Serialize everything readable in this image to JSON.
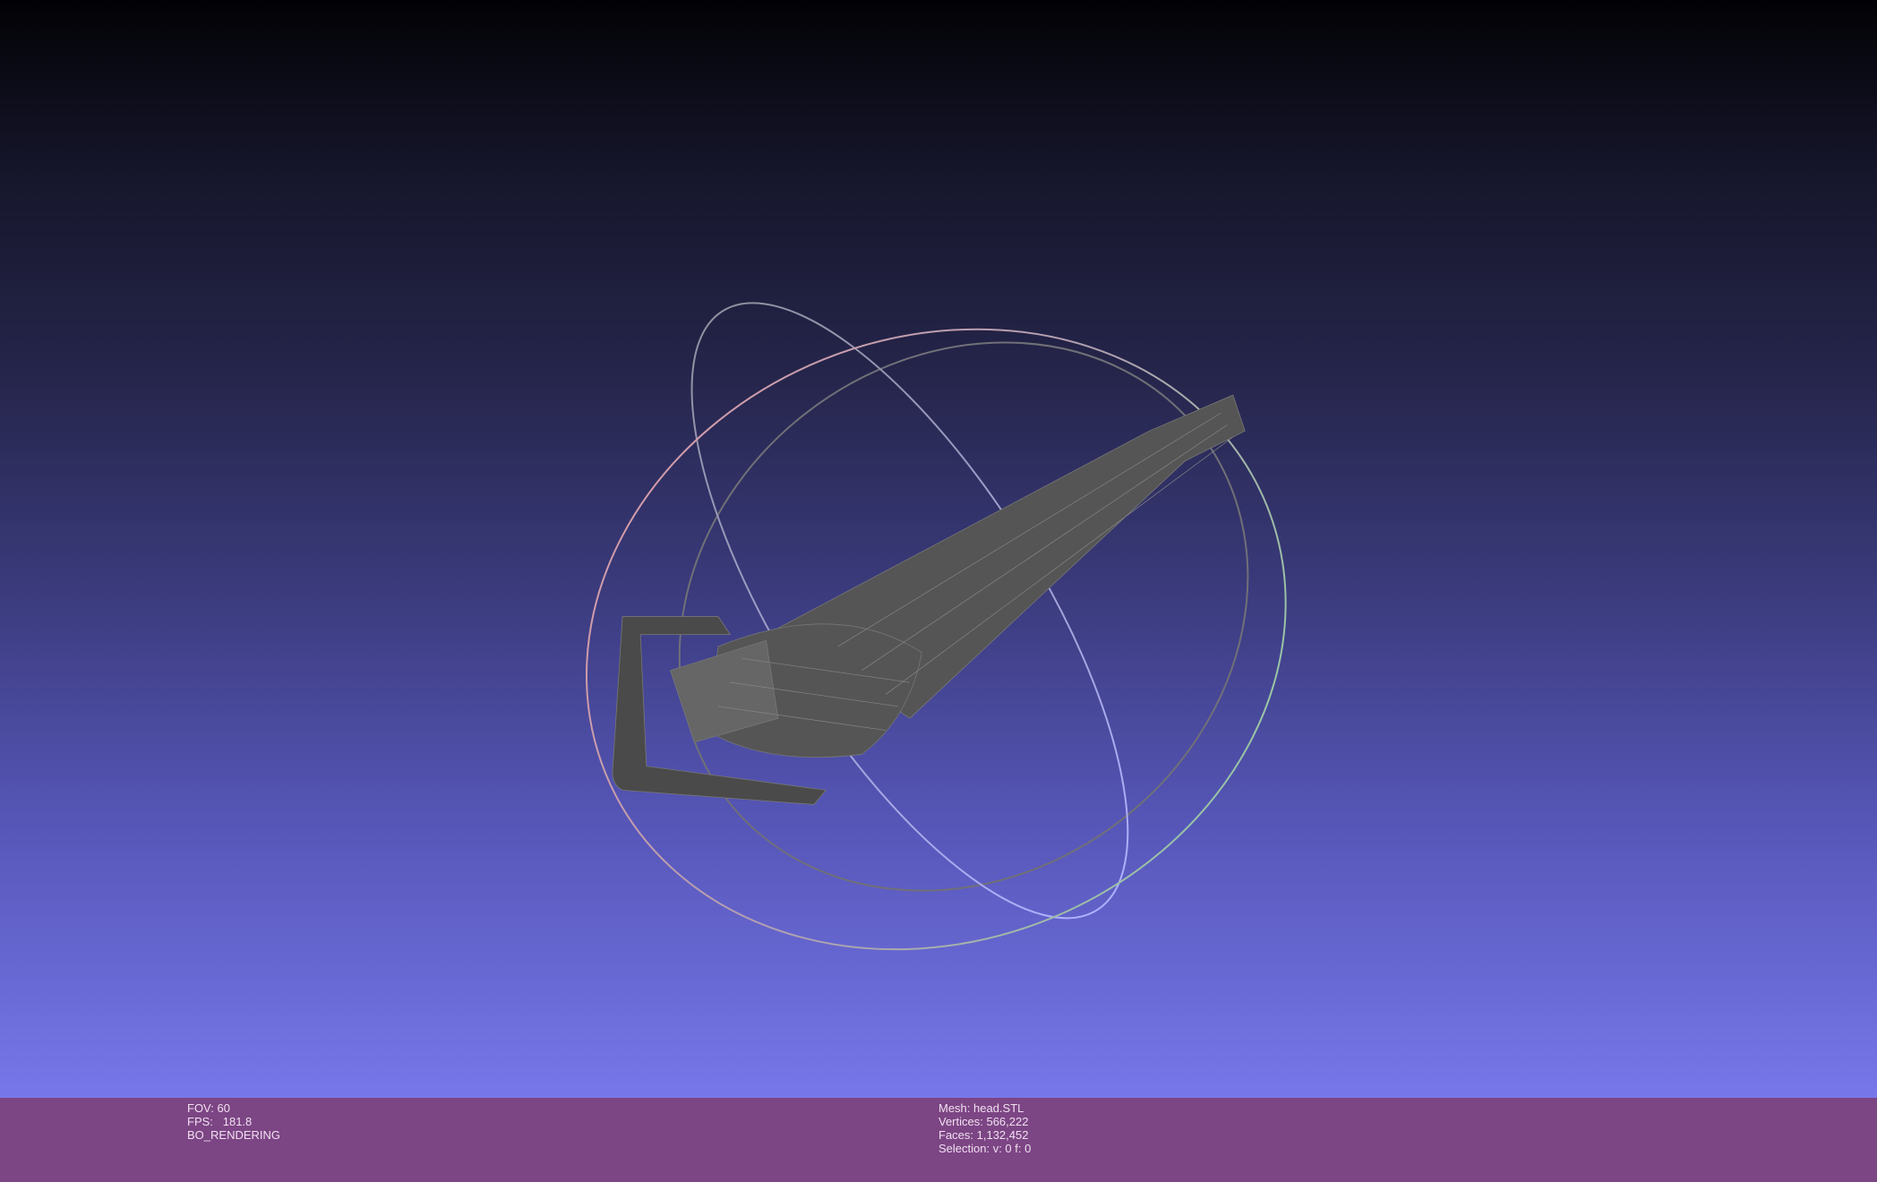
{
  "viewport": {
    "background_top": "#020205",
    "background_bottom": "#7777ea"
  },
  "status": {
    "left": {
      "fov": "FOV: 60",
      "fps": "FPS:   181.8",
      "mode": "BO_RENDERING"
    },
    "right": {
      "mesh": "Mesh: head.STL",
      "vertices": "Vertices: 566,222",
      "faces": "Faces: 1,132,452",
      "selection": "Selection: v: 0 f: 0"
    }
  },
  "colors": {
    "statusbar": "#7c4584",
    "mesh": "#555555"
  }
}
